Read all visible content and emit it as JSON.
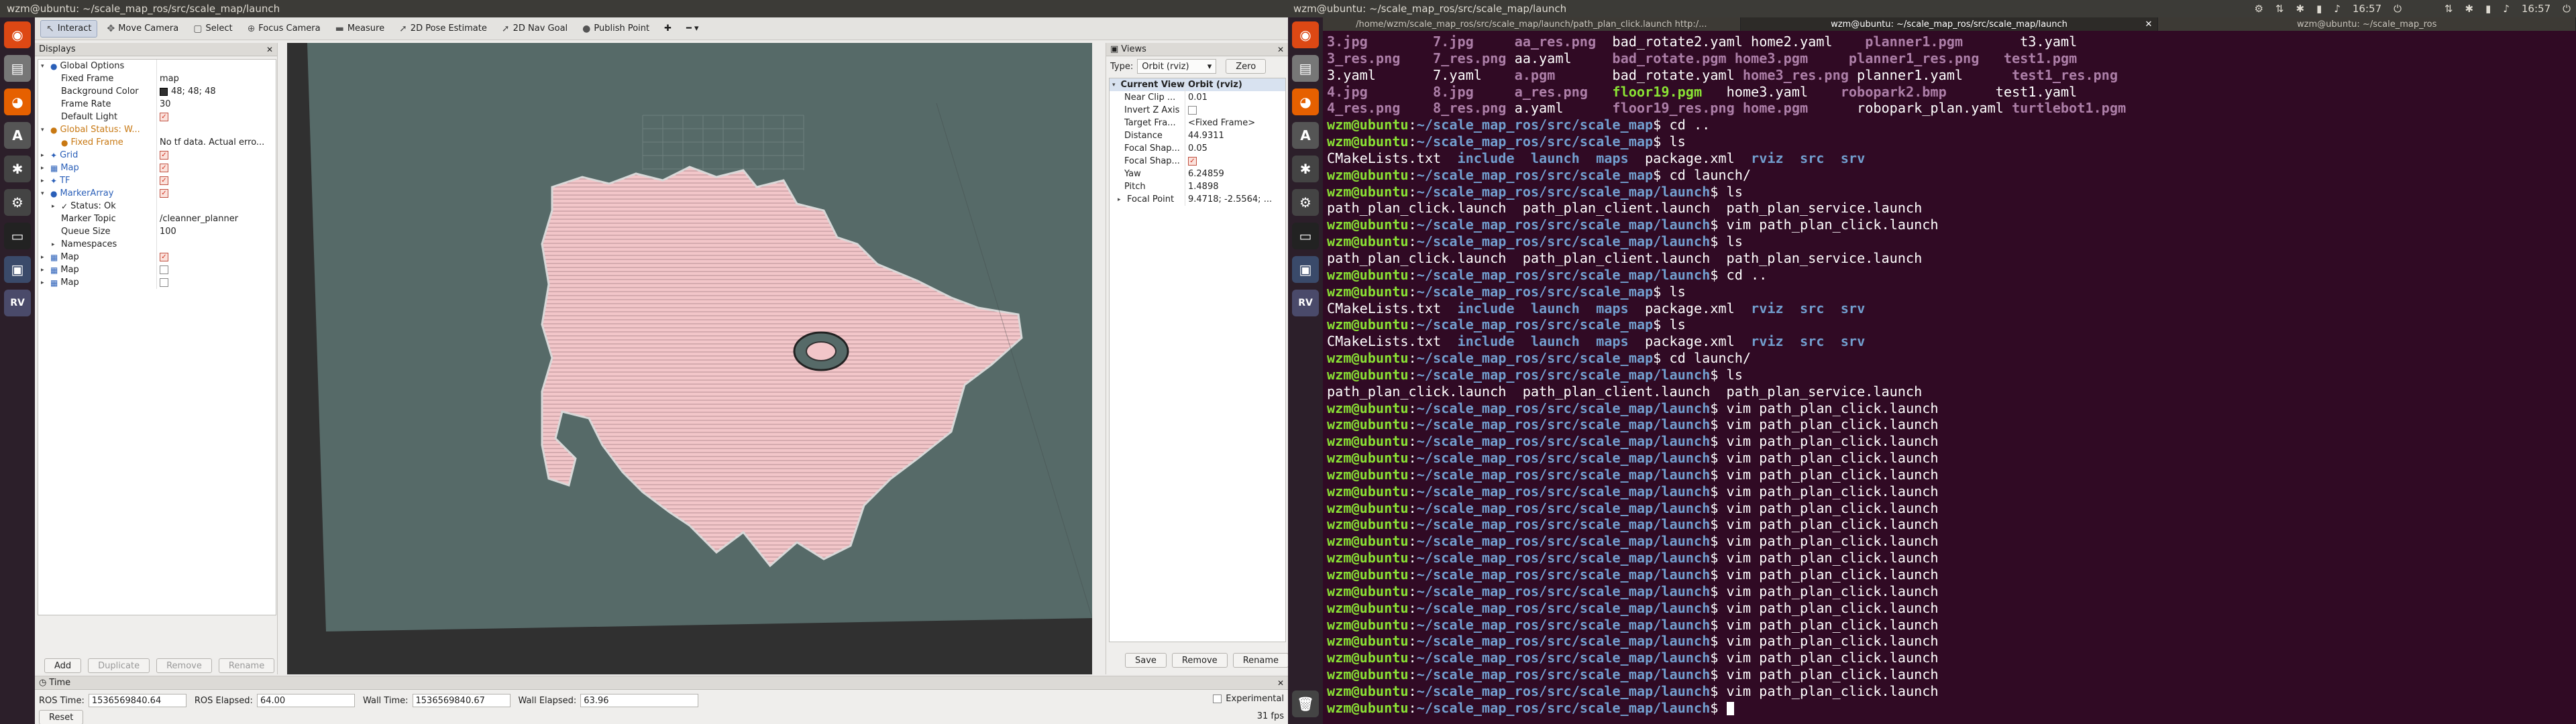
{
  "topbar": {
    "left_title": "wzm@ubuntu: ~/scale_map_ros/src/scale_map/launch",
    "right_title": "wzm@ubuntu: ~/scale_map_ros/src/scale_map/launch",
    "time": "16:57"
  },
  "rviz": {
    "toolbar": [
      {
        "label": "Interact",
        "icon": "interact-icon",
        "glyph": "↖",
        "active": true
      },
      {
        "label": "Move Camera",
        "icon": "move-camera-icon",
        "glyph": "✥",
        "active": false
      },
      {
        "label": "Select",
        "icon": "select-icon",
        "glyph": "▢",
        "active": false
      },
      {
        "label": "Focus Camera",
        "icon": "focus-camera-icon",
        "glyph": "⊕",
        "active": false
      },
      {
        "label": "Measure",
        "icon": "measure-icon",
        "glyph": "▬",
        "active": false
      },
      {
        "label": "2D Pose Estimate",
        "icon": "pose-estimate-icon",
        "glyph": "➚",
        "active": false
      },
      {
        "label": "2D Nav Goal",
        "icon": "nav-goal-icon",
        "glyph": "➚",
        "active": false
      },
      {
        "label": "Publish Point",
        "icon": "publish-point-icon",
        "glyph": "●",
        "active": false
      }
    ],
    "displays_title": "Displays",
    "display_tree": [
      {
        "indent": 0,
        "arrow": "▾",
        "icon": "●",
        "icls": "blue",
        "key": "Global Options",
        "kcls": "",
        "val": "",
        "chk": null
      },
      {
        "indent": 1,
        "arrow": "",
        "icon": "",
        "icls": "",
        "key": "Fixed Frame",
        "kcls": "",
        "val": "map",
        "chk": null
      },
      {
        "indent": 1,
        "arrow": "",
        "icon": "",
        "icls": "",
        "key": "Background Color",
        "kcls": "",
        "val": "48; 48; 48",
        "swatch": "#303030",
        "chk": null
      },
      {
        "indent": 1,
        "arrow": "",
        "icon": "",
        "icls": "",
        "key": "Frame Rate",
        "kcls": "",
        "val": "30",
        "chk": null
      },
      {
        "indent": 1,
        "arrow": "",
        "icon": "",
        "icls": "",
        "key": "Default Light",
        "kcls": "",
        "val": "",
        "chk": true
      },
      {
        "indent": 0,
        "arrow": "▾",
        "icon": "●",
        "icls": "orange",
        "key": "Global Status: W...",
        "kcls": "orange",
        "val": "",
        "chk": null
      },
      {
        "indent": 1,
        "arrow": "",
        "icon": "●",
        "icls": "orange",
        "key": "Fixed Frame",
        "kcls": "orange",
        "val": "No tf data.  Actual erro...",
        "chk": null
      },
      {
        "indent": 0,
        "arrow": "▸",
        "icon": "✦",
        "icls": "blue",
        "key": "Grid",
        "kcls": "blue",
        "val": "",
        "chk": true
      },
      {
        "indent": 0,
        "arrow": "▸",
        "icon": "▦",
        "icls": "blue",
        "key": "Map",
        "kcls": "blue",
        "val": "",
        "chk": true
      },
      {
        "indent": 0,
        "arrow": "▸",
        "icon": "✦",
        "icls": "blue",
        "key": "TF",
        "kcls": "blue",
        "val": "",
        "chk": true
      },
      {
        "indent": 0,
        "arrow": "▾",
        "icon": "●",
        "icls": "blue",
        "key": "MarkerArray",
        "kcls": "blue",
        "val": "",
        "chk": true
      },
      {
        "indent": 1,
        "arrow": "▸",
        "icon": "✓",
        "icls": "",
        "key": "Status: Ok",
        "kcls": "",
        "val": "",
        "chk": null
      },
      {
        "indent": 1,
        "arrow": "",
        "icon": "",
        "icls": "",
        "key": "Marker Topic",
        "kcls": "",
        "val": "/cleanner_planner",
        "chk": null
      },
      {
        "indent": 1,
        "arrow": "",
        "icon": "",
        "icls": "",
        "key": "Queue Size",
        "kcls": "",
        "val": "100",
        "chk": null
      },
      {
        "indent": 1,
        "arrow": "▸",
        "icon": "",
        "icls": "",
        "key": "Namespaces",
        "kcls": "",
        "val": "",
        "chk": null
      },
      {
        "indent": 0,
        "arrow": "▸",
        "icon": "▦",
        "icls": "blue",
        "key": "Map",
        "kcls": "",
        "val": "",
        "chk": true
      },
      {
        "indent": 0,
        "arrow": "▸",
        "icon": "▦",
        "icls": "blue",
        "key": "Map",
        "kcls": "",
        "val": "",
        "chk": false
      },
      {
        "indent": 0,
        "arrow": "▸",
        "icon": "▦",
        "icls": "blue",
        "key": "Map",
        "kcls": "",
        "val": "",
        "chk": false
      }
    ],
    "display_buttons": [
      "Add",
      "Duplicate",
      "Remove",
      "Rename"
    ],
    "views_title": "Views",
    "views_type_label": "Type:",
    "views_type_value": "Orbit (rviz)",
    "views_zero": "Zero",
    "view_tree": [
      {
        "key": "Current View",
        "val": "Orbit (rviz)",
        "hdr": true,
        "arrow": "▾"
      },
      {
        "key": "Near Clip ...",
        "val": "0.01"
      },
      {
        "key": "Invert Z Axis",
        "val": "",
        "chk": false
      },
      {
        "key": "Target Fra...",
        "val": "<Fixed Frame>"
      },
      {
        "key": "Distance",
        "val": "44.9311"
      },
      {
        "key": "Focal Shap...",
        "val": "0.05"
      },
      {
        "key": "Focal Shap...",
        "val": "",
        "chk": true
      },
      {
        "key": "Yaw",
        "val": "6.24859"
      },
      {
        "key": "Pitch",
        "val": "1.4898"
      },
      {
        "key": "Focal Point",
        "val": "9.4718; -2.5564; ...",
        "arrow": "▸"
      }
    ],
    "view_buttons": [
      "Save",
      "Remove",
      "Rename"
    ],
    "time_title": "Time",
    "ros_time_label": "ROS Time:",
    "ros_time": "1536569840.64",
    "ros_elapsed_label": "ROS Elapsed:",
    "ros_elapsed": "64.00",
    "wall_time_label": "Wall Time:",
    "wall_time": "1536569840.67",
    "wall_elapsed_label": "Wall Elapsed:",
    "wall_elapsed": "63.96",
    "experimental": "Experimental",
    "reset": "Reset",
    "fps": "31 fps"
  },
  "terminal": {
    "tabs": [
      "/home/wzm/scale_map_ros/src/scale_map/launch/path_plan_click.launch http:/...",
      "wzm@ubuntu: ~/scale_map_ros/src/scale_map/launch",
      "wzm@ubuntu: ~/scale_map_ros"
    ],
    "prompt_user": "wzm@ubuntu",
    "lines": [
      {
        "t": "ls6",
        "cols": [
          [
            "3.jpg",
            "p"
          ],
          [
            "7.jpg",
            "p"
          ],
          [
            "aa_res.png",
            "p"
          ],
          [
            "bad_rotate2.yaml",
            ""
          ],
          [
            "home2.yaml",
            ""
          ],
          [
            "planner1.pgm",
            "p"
          ],
          [
            "t3.yaml",
            ""
          ]
        ]
      },
      {
        "t": "ls6",
        "cols": [
          [
            "3_res.png",
            "p"
          ],
          [
            "7_res.png",
            "p"
          ],
          [
            "aa.yaml",
            ""
          ],
          [
            "bad_rotate.pgm",
            "p"
          ],
          [
            "home3.pgm",
            "p"
          ],
          [
            "planner1_res.png",
            "p"
          ],
          [
            "test1.pgm",
            "p"
          ]
        ]
      },
      {
        "t": "ls6",
        "cols": [
          [
            "3.yaml",
            ""
          ],
          [
            "7.yaml",
            ""
          ],
          [
            "a.pgm",
            "p"
          ],
          [
            "bad_rotate.yaml",
            ""
          ],
          [
            "home3_res.png",
            "p"
          ],
          [
            "planner1.yaml",
            ""
          ],
          [
            "test1_res.png",
            "p"
          ]
        ]
      },
      {
        "t": "ls6",
        "cols": [
          [
            "4.jpg",
            "p"
          ],
          [
            "8.jpg",
            "p"
          ],
          [
            "a_res.png",
            "p"
          ],
          [
            "floor19.pgm",
            "g"
          ],
          [
            "home3.yaml",
            ""
          ],
          [
            "robopark2.bmp",
            "p"
          ],
          [
            "test1.yaml",
            ""
          ]
        ]
      },
      {
        "t": "ls6",
        "cols": [
          [
            "4_res.png",
            "p"
          ],
          [
            "8_res.png",
            "p"
          ],
          [
            "a.yaml",
            ""
          ],
          [
            "floor19_res.png",
            "p"
          ],
          [
            "home.pgm",
            "p"
          ],
          [
            "robopark_plan.yaml",
            ""
          ],
          [
            "turtlebot1.pgm",
            "p"
          ]
        ]
      },
      {
        "t": "prompt",
        "path": "~/scale_map_ros/src/scale_map",
        "cmd": " cd .."
      },
      {
        "t": "prompt",
        "path": "~/scale_map_ros/src/scale_map",
        "cmd": " ls"
      },
      {
        "t": "lsdir",
        "text": "CMakeLists.txt"
      },
      {
        "t": "prompt",
        "path": "~/scale_map_ros/src/scale_map",
        "cmd": " cd launch/"
      },
      {
        "t": "prompt",
        "path": "~/scale_map_ros/src/scale_map/launch",
        "cmd": " ls"
      },
      {
        "t": "plain",
        "text": "path_plan_click.launch  path_plan_client.launch  path_plan_service.launch"
      },
      {
        "t": "prompt",
        "path": "~/scale_map_ros/src/scale_map/launch",
        "cmd": " vim path_plan_click.launch"
      },
      {
        "t": "prompt",
        "path": "~/scale_map_ros/src/scale_map/launch",
        "cmd": " ls"
      },
      {
        "t": "plain",
        "text": "path_plan_click.launch  path_plan_client.launch  path_plan_service.launch"
      },
      {
        "t": "prompt",
        "path": "~/scale_map_ros/src/scale_map/launch",
        "cmd": " cd .."
      },
      {
        "t": "prompt",
        "path": "~/scale_map_ros/src/scale_map",
        "cmd": " ls"
      },
      {
        "t": "lsdir",
        "text": "CMakeLists.txt"
      },
      {
        "t": "prompt",
        "path": "~/scale_map_ros/src/scale_map",
        "cmd": " ls"
      },
      {
        "t": "lsdir",
        "text": "CMakeLists.txt"
      },
      {
        "t": "prompt",
        "path": "~/scale_map_ros/src/scale_map",
        "cmd": " cd launch/"
      },
      {
        "t": "prompt",
        "path": "~/scale_map_ros/src/scale_map/launch",
        "cmd": " ls"
      },
      {
        "t": "plain",
        "text": "path_plan_click.launch  path_plan_client.launch  path_plan_service.launch"
      },
      {
        "t": "prompt",
        "path": "~/scale_map_ros/src/scale_map/launch",
        "cmd": " vim path_plan_click.launch"
      },
      {
        "t": "prompt",
        "path": "~/scale_map_ros/src/scale_map/launch",
        "cmd": " vim path_plan_click.launch"
      },
      {
        "t": "prompt",
        "path": "~/scale_map_ros/src/scale_map/launch",
        "cmd": " vim path_plan_click.launch"
      },
      {
        "t": "prompt",
        "path": "~/scale_map_ros/src/scale_map/launch",
        "cmd": " vim path_plan_click.launch"
      },
      {
        "t": "prompt",
        "path": "~/scale_map_ros/src/scale_map/launch",
        "cmd": " vim path_plan_click.launch"
      },
      {
        "t": "prompt",
        "path": "~/scale_map_ros/src/scale_map/launch",
        "cmd": " vim path_plan_click.launch"
      },
      {
        "t": "prompt",
        "path": "~/scale_map_ros/src/scale_map/launch",
        "cmd": " vim path_plan_click.launch"
      },
      {
        "t": "prompt",
        "path": "~/scale_map_ros/src/scale_map/launch",
        "cmd": " vim path_plan_click.launch"
      },
      {
        "t": "prompt",
        "path": "~/scale_map_ros/src/scale_map/launch",
        "cmd": " vim path_plan_click.launch"
      },
      {
        "t": "prompt",
        "path": "~/scale_map_ros/src/scale_map/launch",
        "cmd": " vim path_plan_click.launch"
      },
      {
        "t": "prompt",
        "path": "~/scale_map_ros/src/scale_map/launch",
        "cmd": " vim path_plan_click.launch"
      },
      {
        "t": "prompt",
        "path": "~/scale_map_ros/src/scale_map/launch",
        "cmd": " vim path_plan_click.launch"
      },
      {
        "t": "prompt",
        "path": "~/scale_map_ros/src/scale_map/launch",
        "cmd": " vim path_plan_click.launch"
      },
      {
        "t": "prompt",
        "path": "~/scale_map_ros/src/scale_map/launch",
        "cmd": " vim path_plan_click.launch"
      },
      {
        "t": "prompt",
        "path": "~/scale_map_ros/src/scale_map/launch",
        "cmd": " vim path_plan_click.launch"
      },
      {
        "t": "prompt",
        "path": "~/scale_map_ros/src/scale_map/launch",
        "cmd": " vim path_plan_click.launch"
      },
      {
        "t": "prompt",
        "path": "~/scale_map_ros/src/scale_map/launch",
        "cmd": " vim path_plan_click.launch"
      },
      {
        "t": "prompt",
        "path": "~/scale_map_ros/src/scale_map/launch",
        "cmd": " vim path_plan_click.launch"
      },
      {
        "t": "prompt",
        "path": "~/scale_map_ros/src/scale_map/launch",
        "cmd": " ",
        "cursor": true
      }
    ],
    "dir_listing": [
      [
        "CMakeLists.txt",
        ""
      ],
      [
        "include",
        "b"
      ],
      [
        "launch",
        "b"
      ],
      [
        "maps",
        "b"
      ],
      [
        "package.xml",
        ""
      ],
      [
        "rviz",
        "b"
      ],
      [
        "src",
        "b"
      ],
      [
        "srv",
        "b"
      ]
    ]
  },
  "colors": {
    "terminal_bg": "#300a24",
    "prompt_green": "#8ae234",
    "path_blue": "#729fcf",
    "image_magenta": "#ad7fa8",
    "map_pink": "#f2c6c9",
    "grid_floor": "#566a68"
  }
}
